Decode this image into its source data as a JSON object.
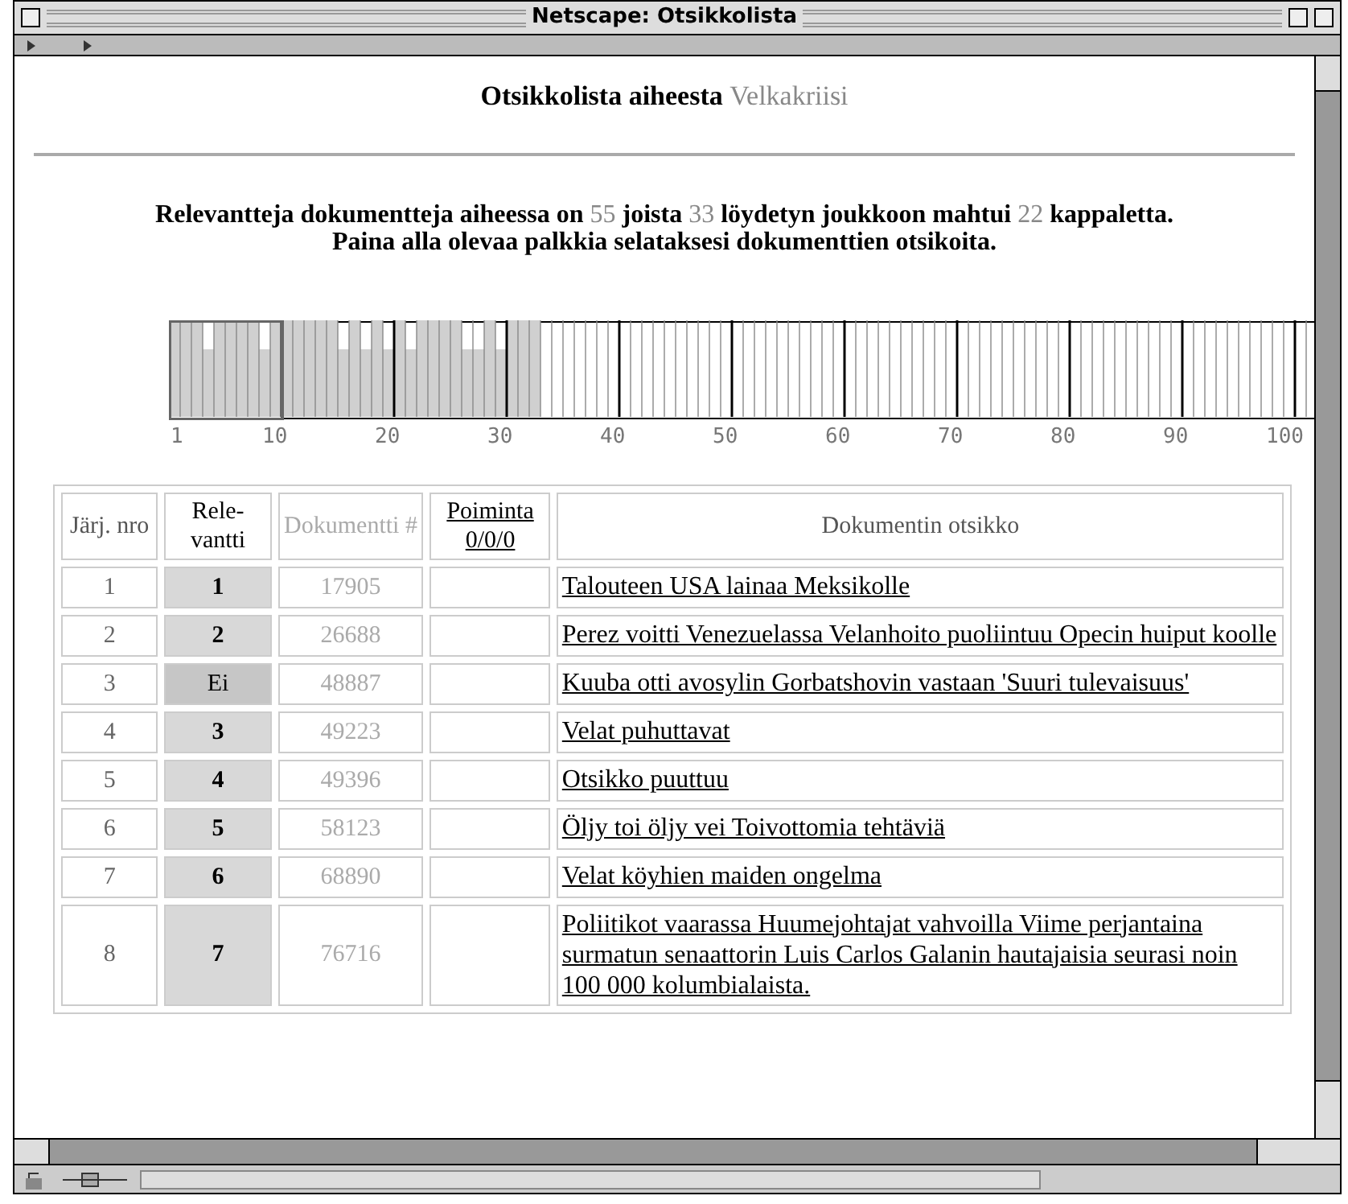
{
  "window": {
    "title": "Netscape: Otsikkolista"
  },
  "heading": {
    "text": "Otsikkolista aiheesta",
    "topic": "Velkakriisi"
  },
  "summary": {
    "parts": [
      "Relevantteja dokumentteja aiheessa on",
      "55",
      "joista",
      "33",
      "löydetyn joukkoon mahtui",
      "22",
      "kappaletta."
    ],
    "instruction": "Paina alla olevaa palkkia selataksesi dokumenttien otsikoita."
  },
  "navigator": {
    "ticks": [
      "1",
      "10",
      "20",
      "30",
      "40",
      "50",
      "60",
      "70",
      "80",
      "90",
      "100"
    ]
  },
  "table": {
    "columns": [
      {
        "label": "Järj. nro",
        "kind": "plain"
      },
      {
        "label": "Rele-vantti",
        "kind": "strong"
      },
      {
        "label": "Dokumentti #",
        "kind": "faint"
      },
      {
        "label": "Poiminta",
        "sub": "0/0/0",
        "kind": "link"
      },
      {
        "label": "Dokumentin otsikko",
        "kind": "plain"
      }
    ],
    "rows": [
      {
        "nro": "1",
        "relevant": "1",
        "relevant_flag": true,
        "doc": "17905",
        "title": "Talouteen USA lainaa Meksikolle"
      },
      {
        "nro": "2",
        "relevant": "2",
        "relevant_flag": true,
        "doc": "26688",
        "title": "Perez voitti Venezuelassa Velanhoito puoliintuu Opecin huiput koolle"
      },
      {
        "nro": "3",
        "relevant": "Ei",
        "relevant_flag": false,
        "doc": "48887",
        "title": "Kuuba otti avosylin Gorbatshovin vastaan 'Suuri tulevaisuus'"
      },
      {
        "nro": "4",
        "relevant": "3",
        "relevant_flag": true,
        "doc": "49223",
        "title": "Velat puhuttavat"
      },
      {
        "nro": "5",
        "relevant": "4",
        "relevant_flag": true,
        "doc": "49396",
        "title": "Otsikko puuttuu"
      },
      {
        "nro": "6",
        "relevant": "5",
        "relevant_flag": true,
        "doc": "58123",
        "title": "Öljy toi öljy vei Toivottomia tehtäviä"
      },
      {
        "nro": "7",
        "relevant": "6",
        "relevant_flag": true,
        "doc": "68890",
        "title": "Velat köyhien maiden ongelma"
      },
      {
        "nro": "8",
        "relevant": "7",
        "relevant_flag": true,
        "doc": "76716",
        "title": "Poliitikot vaarassa Huumejohtajat vahvoilla Viime perjantaina surmatun senaattorin Luis Carlos Galanin hautajaisia seurasi noin 100 000 kolumbialaista."
      }
    ]
  }
}
